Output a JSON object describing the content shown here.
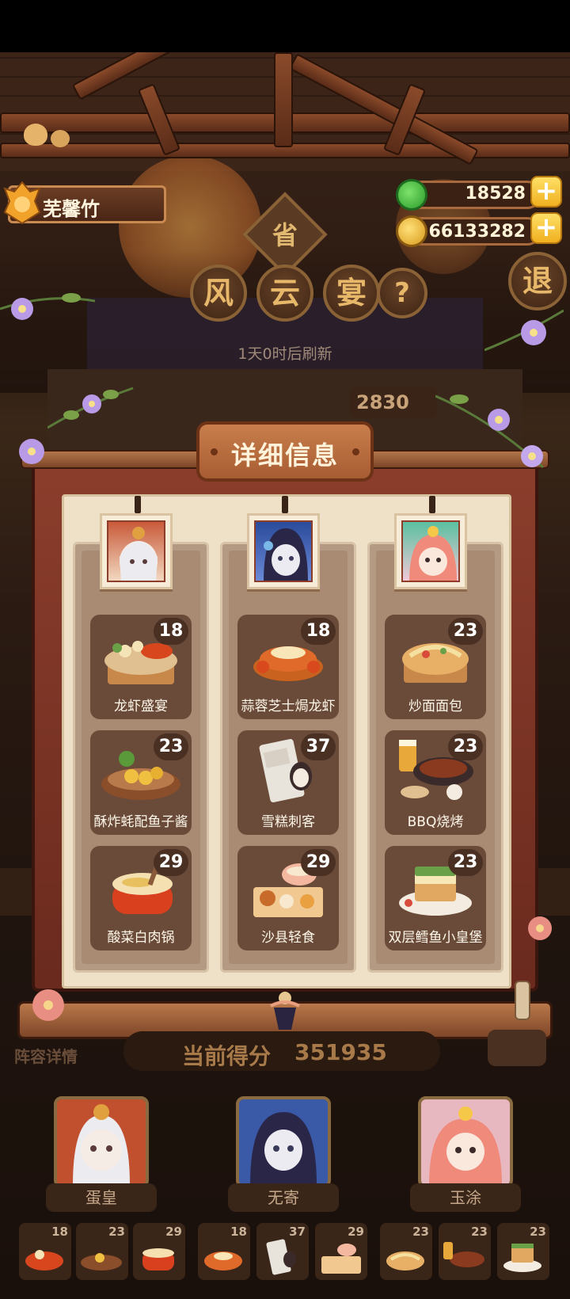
{
  "player": {
    "name": "芜馨竹"
  },
  "currency": {
    "jade": "18528",
    "coins": "66133282"
  },
  "event": {
    "badge": "省",
    "title_chars": [
      "风",
      "云",
      "宴"
    ],
    "help": "?",
    "exit": "退",
    "refresh": "1天0时后刷新",
    "score_peek": "2830"
  },
  "modal": {
    "title": "详细信息",
    "columns": [
      {
        "dishes": [
          {
            "name": "龙虾盛宴",
            "level": "18"
          },
          {
            "name": "酥炸蚝配鱼子酱",
            "level": "23"
          },
          {
            "name": "酸菜白肉锅",
            "level": "29"
          }
        ]
      },
      {
        "dishes": [
          {
            "name": "蒜蓉芝士焗龙虾",
            "level": "18"
          },
          {
            "name": "雪糕刺客",
            "level": "37"
          },
          {
            "name": "沙县轻食",
            "level": "29"
          }
        ]
      },
      {
        "dishes": [
          {
            "name": "炒面面包",
            "level": "23"
          },
          {
            "name": "BBQ烧烤",
            "level": "23"
          },
          {
            "name": "双层鳕鱼小皇堡",
            "level": "23"
          }
        ]
      }
    ]
  },
  "bottom": {
    "lineup_label": "阵容详情",
    "score_label": "当前得分",
    "score_value": "351935",
    "characters": [
      {
        "name": "蛋皇"
      },
      {
        "name": "无寄"
      },
      {
        "name": "玉涂"
      }
    ],
    "mini_levels": [
      "18",
      "23",
      "29",
      "18",
      "37",
      "29",
      "23",
      "23",
      "23"
    ]
  },
  "colors": {
    "accent": "#c97e4c",
    "paper": "#efe0c8",
    "frame": "#8c3e2c"
  }
}
